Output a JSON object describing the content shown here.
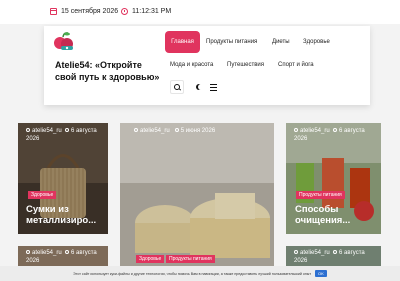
{
  "topbar": {
    "date": "15 сентября 2026",
    "time": "11:12:31 PM"
  },
  "header": {
    "site_title": "Atelie54: «Откройте свой путь к здоровью»",
    "nav_active": "Главная",
    "nav": [
      "Продукты питания",
      "Диеты",
      "Здоровье",
      "Мода и красота",
      "Путешествия",
      "Спорт и йога"
    ]
  },
  "cards": [
    {
      "author": "atelie54_ru",
      "date": "6 августа 2026",
      "tags": [
        "Здоровье"
      ],
      "title": "Сумки из металлизиро..."
    },
    {
      "author": "atelie54_ru",
      "date": "5 июня 2026",
      "tags": [
        "Здоровье",
        "Продукты питания"
      ],
      "title": ""
    },
    {
      "author": "atelie54_ru",
      "date": "6 августа 2026",
      "tags": [
        "Продукты питания"
      ],
      "title": "Способы очищения..."
    },
    {
      "author": "atelie54_ru",
      "date": "6 августа 2026"
    },
    {
      "author": "atelie54_ru",
      "date": "6 августа 2026"
    }
  ],
  "cookie": {
    "text": "Этот сайт использует куки-файлы и другие технологии, чтобы помочь Вам в навигации, а также предоставить лучший пользовательский опыт",
    "ok": "OK"
  },
  "colors": {
    "accent": "#e0345e",
    "cookie_button": "#2c6fd1"
  }
}
